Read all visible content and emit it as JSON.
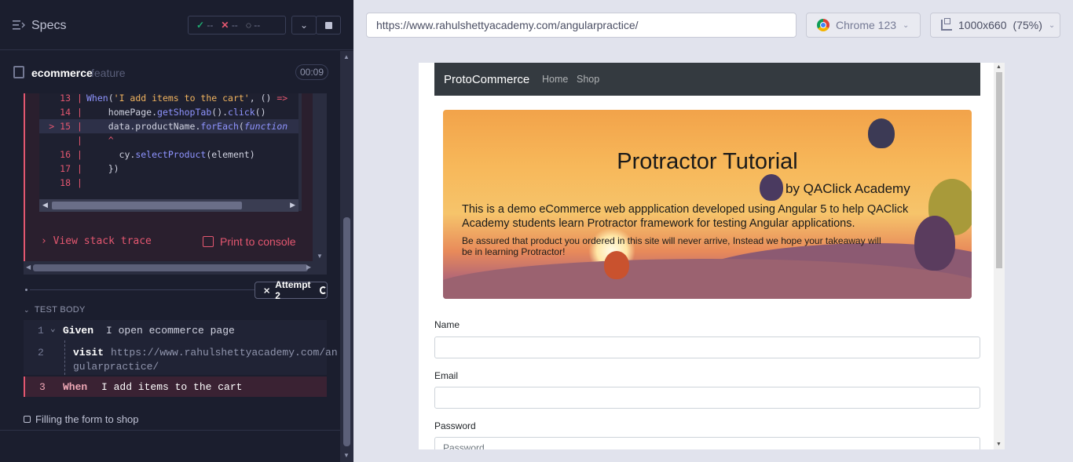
{
  "reporter": {
    "specs_label": "Specs",
    "stats": {
      "passed": "--",
      "failed": "--",
      "pending": "--"
    },
    "spec": {
      "name": "ecommerce",
      "ext": "feature",
      "timer": "00:09"
    },
    "code_lines": [
      {
        "num": "13",
        "text": "When('I add items to the cart', () =>"
      },
      {
        "num": "14",
        "text": "    homePage.getShopTab().click()"
      },
      {
        "num": "> 15",
        "text": "    data.productName.forEach(function"
      },
      {
        "num": "",
        "text": "    ^"
      },
      {
        "num": "16",
        "text": "      cy.selectProduct(element)"
      },
      {
        "num": "17",
        "text": "    })"
      },
      {
        "num": "18",
        "text": ""
      }
    ],
    "view_stack_trace": "View stack trace",
    "print_to_console": "Print to console",
    "attempt": "Attempt 2",
    "test_body_label": "TEST BODY",
    "commands": [
      {
        "num": "1",
        "keyword": "Given",
        "message": "I open ecommerce page"
      },
      {
        "num": "2",
        "keyword": "visit",
        "message": "https://www.rahulshettyacademy.com/an",
        "message2": "gularpractice/"
      },
      {
        "num": "3",
        "keyword": "When",
        "message": "I add items to the cart"
      }
    ],
    "next_test": "Filling the form to shop"
  },
  "aut": {
    "url": "https://www.rahulshettyacademy.com/angularpractice/",
    "browser": "Chrome 123",
    "viewport": "1000x660",
    "scale": "(75%)",
    "navbar": {
      "brand": "ProtoCommerce",
      "links": [
        "Home",
        "Shop"
      ]
    },
    "jumbotron": {
      "title": "Protractor Tutorial",
      "subtitle": "by QAClick Academy",
      "lead": "This is a demo eCommerce web appplication developed using Angular 5 to help QAClick Academy students learn Protractor framework for testing Angular applications.",
      "small": "Be assured that product you ordered in this site will never arrive, Instead we hope your takeaway will be in learning Protractor!"
    },
    "form": {
      "name_label": "Name",
      "email_label": "Email",
      "password_label": "Password",
      "password_placeholder": "Password"
    }
  },
  "colors": {
    "accent_error": "#e45770",
    "success": "#1fa971",
    "navbar": "#343a40"
  }
}
